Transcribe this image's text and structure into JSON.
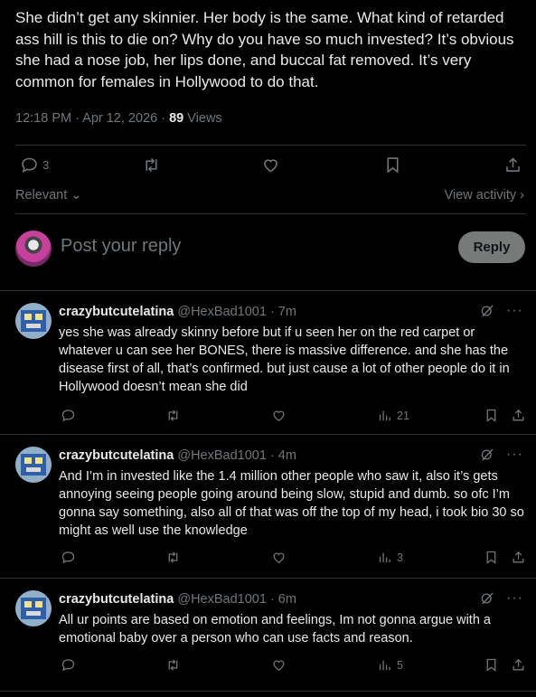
{
  "post": {
    "text": "She didn’t get any skinnier. Her body is the same. What kind of retarded ass hill is this to die on? Why do you have so much invested? It’s obvious she had a nose job, her lips done, and buccal fat removed. It’s very common for females in Hollywood to do that.",
    "time": "12:18 PM · Apr 12, 2026 · ",
    "views_count": "89",
    "views_label": " Views",
    "reply_count": "3"
  },
  "sort": {
    "label": "Relevant",
    "view_activity": "View activity"
  },
  "composer": {
    "placeholder": "Post your reply",
    "button": "Reply"
  },
  "comments": [
    {
      "name": "crazybutcutelatina",
      "handle": "@HexBad1001 · 7m",
      "text": "yes she was already skinny before but if u seen her on the red carpet or whatever u can see her BONES, there is massive difference. and she has the disease first of all, that’s confirmed. but just cause a lot of other people do it in Hollywood doesn’t mean she did",
      "views": "21"
    },
    {
      "name": "crazybutcutelatina",
      "handle": "@HexBad1001 · 4m",
      "text": "And I’m in invested like the 1.4 million other people who saw it, also it’s gets annoying seeing people going around being slow, stupid and dumb. so ofc I’m gonna say something, also all of that was off the top of my head, i took bio 30 so might as well use the knowledge",
      "views": "3"
    },
    {
      "name": "crazybutcutelatina",
      "handle": "@HexBad1001 · 6m",
      "text": "All ur points are based on emotion and feelings, Im not gonna argue with a emotional baby over a person who can use facts and reason.",
      "views": "5"
    }
  ],
  "colors": {
    "background": "#000000",
    "text": "#e7e9ea",
    "muted": "#71767b",
    "divider": "#2f3336",
    "reply_button": "#787a7a"
  }
}
